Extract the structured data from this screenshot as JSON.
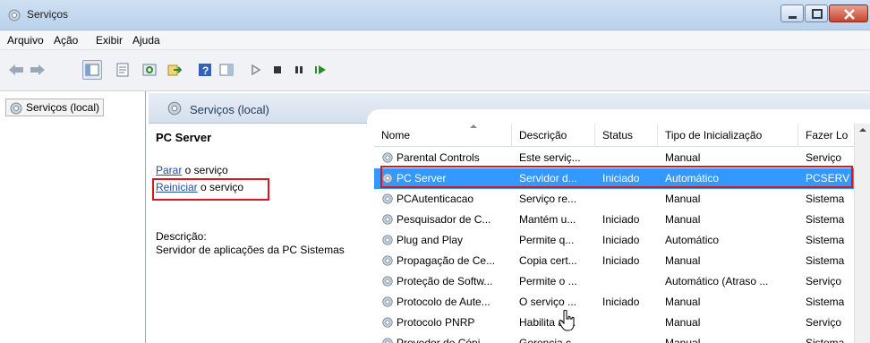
{
  "window": {
    "title": "Serviços"
  },
  "menu": [
    "Arquivo",
    "Ação",
    "Exibir",
    "Ajuda"
  ],
  "tree": {
    "root_label": "Serviços (local)"
  },
  "panel": {
    "header_label": "Serviços (local)"
  },
  "detail": {
    "service_name": "PC Server",
    "stop_link": "Parar",
    "stop_suffix": " o serviço",
    "restart_link": "Reiniciar",
    "restart_suffix": " o serviço",
    "description_label": "Descrição:",
    "description_text": "Servidor de aplicações da PC Sistemas"
  },
  "table": {
    "columns": [
      "Nome",
      "Descrição",
      "Status",
      "Tipo de Inicialização",
      "Fazer Lo"
    ],
    "rows": [
      [
        "Parental Controls",
        "Este serviç...",
        "",
        "Manual",
        "Serviço"
      ],
      [
        "PC Server",
        "Servidor d...",
        "Iniciado",
        "Automático",
        "PCSERV"
      ],
      [
        "PCAutenticacao",
        "Serviço re...",
        "",
        "Manual",
        "Sistema"
      ],
      [
        "Pesquisador de C...",
        "Mantém u...",
        "Iniciado",
        "Manual",
        "Sistema"
      ],
      [
        "Plug and Play",
        "Permite q...",
        "Iniciado",
        "Automático",
        "Sistema"
      ],
      [
        "Propagação de Ce...",
        "Copia cert...",
        "Iniciado",
        "Manual",
        "Sistema"
      ],
      [
        "Proteção de Softw...",
        "Permite o ...",
        "",
        "Automático (Atraso ...",
        "Serviço"
      ],
      [
        "Protocolo de Aute...",
        "O serviço ...",
        "Iniciado",
        "Manual",
        "Sistema"
      ],
      [
        "Protocolo PNRP",
        "Habilita a ...",
        "",
        "Manual",
        "Serviço"
      ],
      [
        "Provedor de Cópi...",
        "Gerencia c...",
        "",
        "Manual",
        "Sistema"
      ]
    ],
    "selected_index": 1
  },
  "colors": {
    "selection": "#3399ff",
    "highlight_box": "#d8171f",
    "link": "#1f4ea3"
  }
}
